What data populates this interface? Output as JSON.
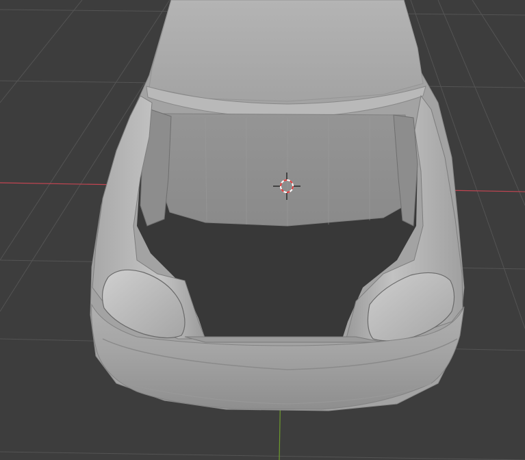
{
  "viewport": {
    "background": "#3d3d3d",
    "grid_color": "#545454",
    "x_axis_color": "#c44552",
    "y_axis_color": "#6e9c2d"
  },
  "model": {
    "body_color": "#a9a9a9",
    "highlight_color": "#c8c8c8",
    "shadow_color": "#7d7d7d",
    "interior_color": "#383838"
  },
  "cursor_3d": {
    "icon": "3d-cursor-icon",
    "ring_color_a": "#e23b3b",
    "ring_color_b": "#ffffff"
  }
}
